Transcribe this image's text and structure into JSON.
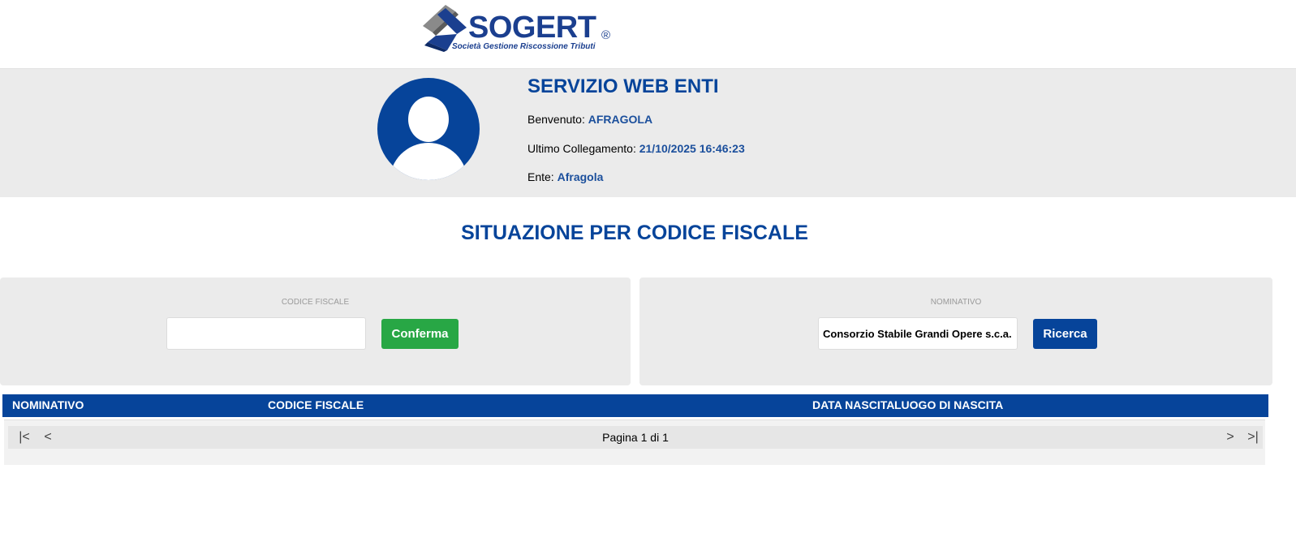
{
  "logo": {
    "wordmark": "SOGERT",
    "registered": "®",
    "tagline": "Società Gestione Riscossione Tributi"
  },
  "header": {
    "service_title": "SERVIZIO WEB ENTI",
    "welcome_label": "Benvenuto:",
    "welcome_value": "AFRAGOLA",
    "last_login_label": "Ultimo Collegamento:",
    "last_login_value": "21/10/2025 16:46:23",
    "ente_label": "Ente:",
    "ente_value": "Afragola"
  },
  "page": {
    "title": "SITUAZIONE PER CODICE FISCALE"
  },
  "search_cf": {
    "label": "CODICE FISCALE",
    "value": "",
    "button": "Conferma"
  },
  "search_name": {
    "label": "NOMINATIVO",
    "value": "Consorzio Stabile Grandi Opere s.c.a.",
    "button": "Ricerca"
  },
  "table": {
    "columns": [
      "NOMINATIVO",
      "CODICE FISCALE",
      "DATA NASCITA",
      "LUOGO DI NASCITA"
    ],
    "rows": []
  },
  "pager": {
    "first": "|<",
    "prev": "<",
    "next": ">",
    "last": ">|",
    "text": "Pagina 1 di 1"
  },
  "colors": {
    "primary": "#06449a",
    "success": "#28a745",
    "band": "#ebebeb"
  }
}
